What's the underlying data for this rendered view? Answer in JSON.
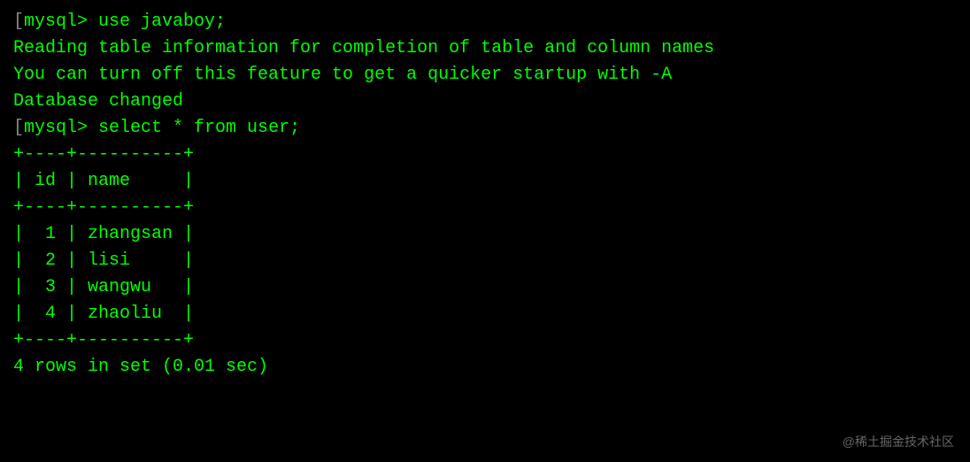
{
  "lines": {
    "prompt1_bracket": "[",
    "prompt1": "mysql> ",
    "command1": "use javaboy;",
    "output1": "Reading table information for completion of table and column names",
    "output2": "You can turn off this feature to get a quicker startup with -A",
    "blank": "",
    "output3": "Database changed",
    "prompt2_bracket": "[",
    "prompt2": "mysql> ",
    "command2": "select * from user;",
    "table_border_top": "+----+----------+",
    "table_header": "| id | name     |",
    "table_border_mid": "+----+----------+",
    "table_row1": "|  1 | zhangsan |",
    "table_row2": "|  2 | lisi     |",
    "table_row3": "|  3 | wangwu   |",
    "table_row4": "|  4 | zhaoliu  |",
    "table_border_bot": "+----+----------+",
    "result_summary": "4 rows in set (0.01 sec)"
  },
  "watermark": "@稀土掘金技术社区",
  "chart_data": {
    "type": "table",
    "title": "user",
    "columns": [
      "id",
      "name"
    ],
    "rows": [
      {
        "id": 1,
        "name": "zhangsan"
      },
      {
        "id": 2,
        "name": "lisi"
      },
      {
        "id": 3,
        "name": "wangwu"
      },
      {
        "id": 4,
        "name": "zhaoliu"
      }
    ],
    "row_count": 4,
    "query_time_sec": 0.01
  }
}
